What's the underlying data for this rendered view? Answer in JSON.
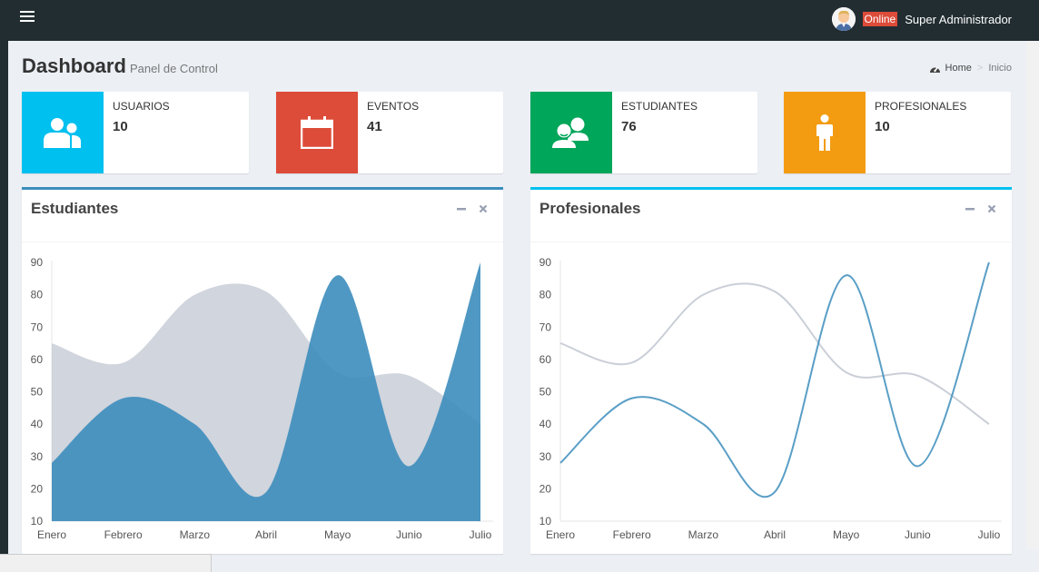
{
  "header": {
    "online_label": "Online",
    "user_name": "Super Administrador",
    "menu_icon": "hamburger-menu-icon"
  },
  "page": {
    "title": "Dashboard",
    "subtitle": "Panel de Control",
    "breadcrumb": {
      "home": "Home",
      "current": "Inicio"
    }
  },
  "info_boxes": [
    {
      "label": "USUARIOS",
      "value": "10",
      "color": "#00c0ef",
      "icon": "users-icon"
    },
    {
      "label": "EVENTOS",
      "value": "41",
      "color": "#dd4b39",
      "icon": "calendar-icon"
    },
    {
      "label": "ESTUDIANTES",
      "value": "76",
      "color": "#00a65a",
      "icon": "students-icon"
    },
    {
      "label": "PROFESIONALES",
      "value": "10",
      "color": "#f39c12",
      "icon": "person-icon"
    }
  ],
  "colors": {
    "series_blue": "#3c8dbc",
    "series_gray": "#c1c7d1",
    "box_border_primary": "#3c8dbc",
    "box_border_info": "#00c0ef"
  },
  "chart_data": [
    {
      "type": "area",
      "title": "Estudiantes",
      "categories": [
        "Enero",
        "Febrero",
        "Marzo",
        "Abril",
        "Mayo",
        "Junio",
        "Julio"
      ],
      "series": [
        {
          "color": "#c1c7d1",
          "values": [
            65,
            59,
            80,
            81,
            56,
            55,
            40
          ]
        },
        {
          "color": "#3c8dbc",
          "values": [
            28,
            48,
            40,
            19,
            86,
            27,
            90
          ]
        }
      ],
      "ylim": [
        10,
        90
      ],
      "yticks": [
        10,
        20,
        30,
        40,
        50,
        60,
        70,
        80,
        90
      ],
      "grid": false
    },
    {
      "type": "line",
      "title": "Profesionales",
      "categories": [
        "Enero",
        "Febrero",
        "Marzo",
        "Abril",
        "Mayo",
        "Junio",
        "Julio"
      ],
      "series": [
        {
          "color": "#c1c7d1",
          "values": [
            65,
            59,
            80,
            81,
            56,
            55,
            40
          ]
        },
        {
          "color": "#3c8dbc",
          "values": [
            28,
            48,
            40,
            19,
            86,
            27,
            90
          ]
        }
      ],
      "ylim": [
        10,
        90
      ],
      "yticks": [
        10,
        20,
        30,
        40,
        50,
        60,
        70,
        80,
        90
      ],
      "grid": false
    }
  ]
}
